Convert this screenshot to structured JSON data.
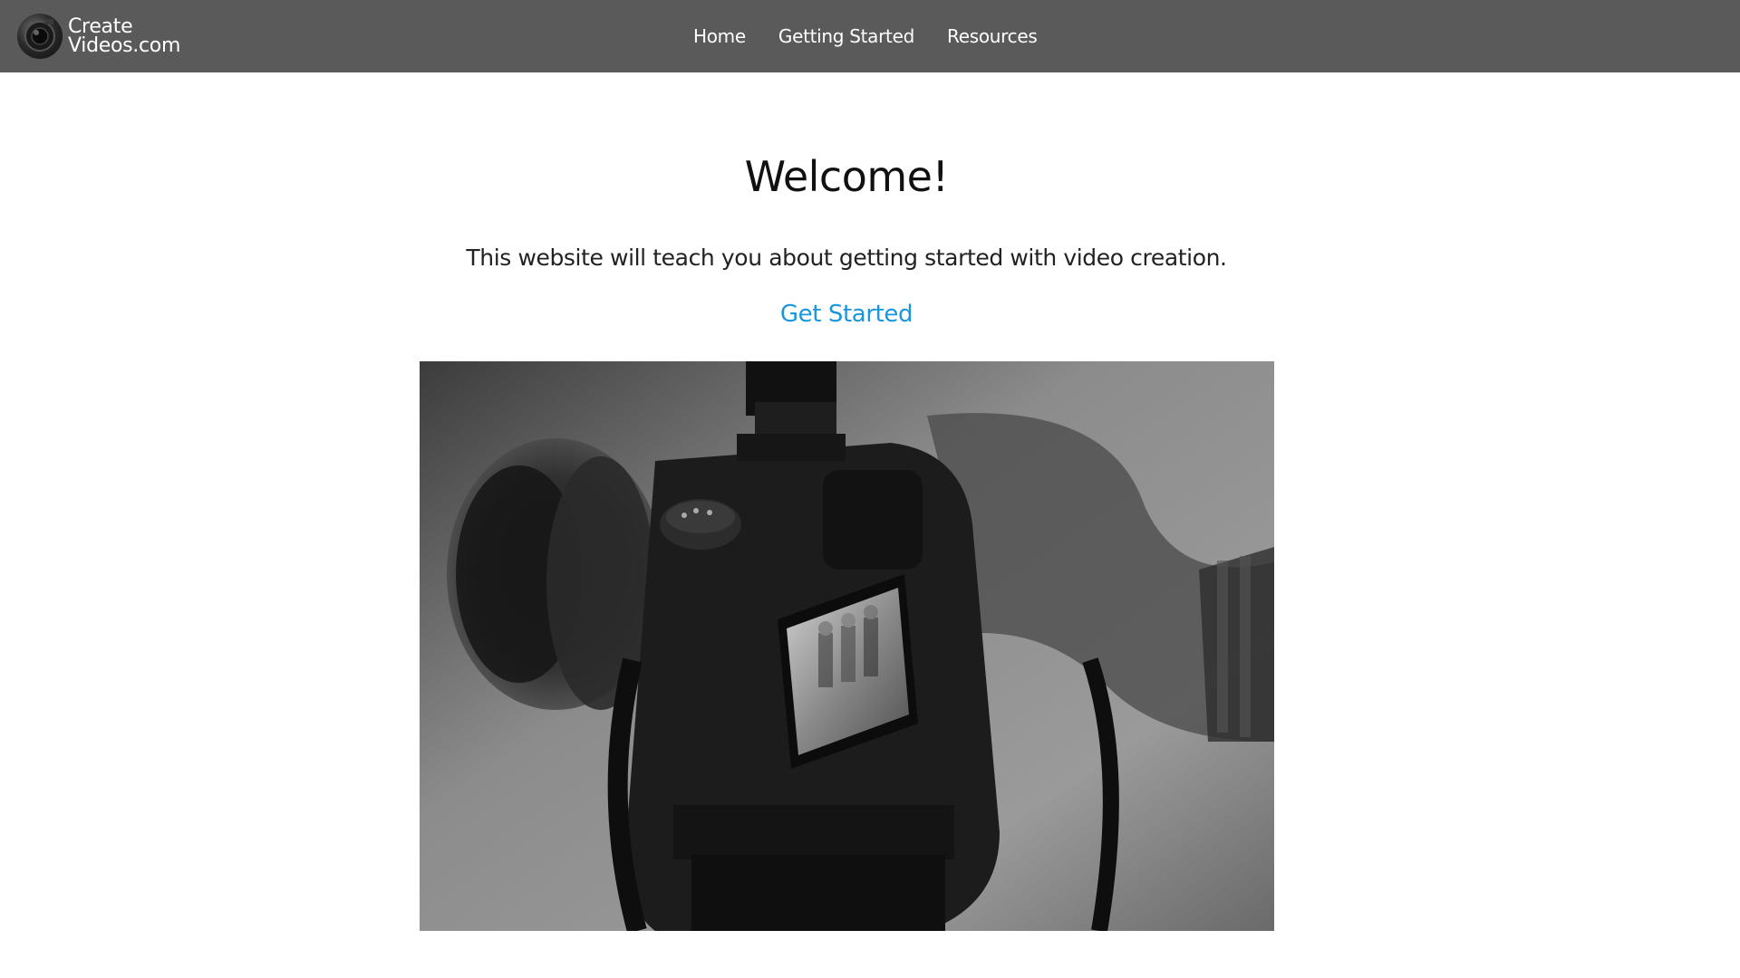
{
  "nav": {
    "brand": {
      "line1": "Create",
      "line2": "Videos.com",
      "logo_icon": "camera-lens-logo-icon"
    },
    "links": [
      {
        "label": "Home"
      },
      {
        "label": "Getting Started"
      },
      {
        "label": "Resources"
      }
    ],
    "background": "#5a5a5a"
  },
  "main": {
    "title": "Welcome!",
    "intro": "This website will teach you about getting started with video creation.",
    "cta_label": "Get Started",
    "cta_color": "#1a97db",
    "hero_image": "camera-photo"
  }
}
